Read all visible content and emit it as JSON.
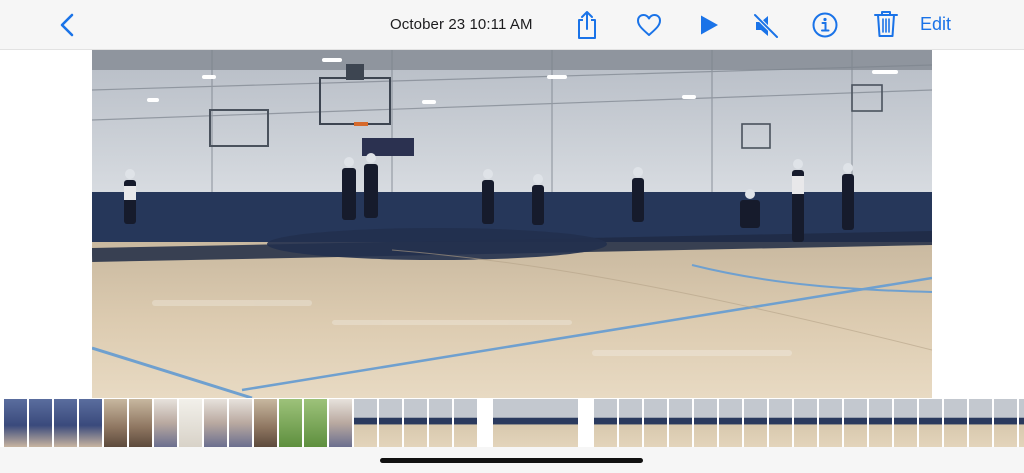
{
  "header": {
    "datetime": "October 23  10:11 AM",
    "edit_label": "Edit",
    "accent_color": "#1a73e8",
    "icons": [
      "chevron-left-icon",
      "share-icon",
      "heart-icon",
      "play-icon",
      "speaker-muted-icon",
      "info-icon",
      "trash-icon"
    ]
  },
  "photo": {
    "subject": "indoor basketball game"
  },
  "filmstrip": {
    "thumbnails": [
      {
        "kind": "people"
      },
      {
        "kind": "people"
      },
      {
        "kind": "people"
      },
      {
        "kind": "people"
      },
      {
        "kind": "room"
      },
      {
        "kind": "room"
      },
      {
        "kind": "kids"
      },
      {
        "kind": "paper"
      },
      {
        "kind": "kids"
      },
      {
        "kind": "kids"
      },
      {
        "kind": "room"
      },
      {
        "kind": "grass"
      },
      {
        "kind": "grass"
      },
      {
        "kind": "kids"
      },
      {
        "kind": "court"
      },
      {
        "kind": "court"
      },
      {
        "kind": "court"
      },
      {
        "kind": "court"
      },
      {
        "kind": "court"
      },
      {
        "kind": "gap"
      },
      {
        "kind": "court-selected"
      },
      {
        "kind": "gap"
      },
      {
        "kind": "court"
      },
      {
        "kind": "court"
      },
      {
        "kind": "court"
      },
      {
        "kind": "court"
      },
      {
        "kind": "court"
      },
      {
        "kind": "court"
      },
      {
        "kind": "court"
      },
      {
        "kind": "court"
      },
      {
        "kind": "court"
      },
      {
        "kind": "court"
      },
      {
        "kind": "court"
      },
      {
        "kind": "court"
      },
      {
        "kind": "court"
      },
      {
        "kind": "court"
      },
      {
        "kind": "court"
      },
      {
        "kind": "court"
      },
      {
        "kind": "court"
      },
      {
        "kind": "court"
      }
    ]
  }
}
